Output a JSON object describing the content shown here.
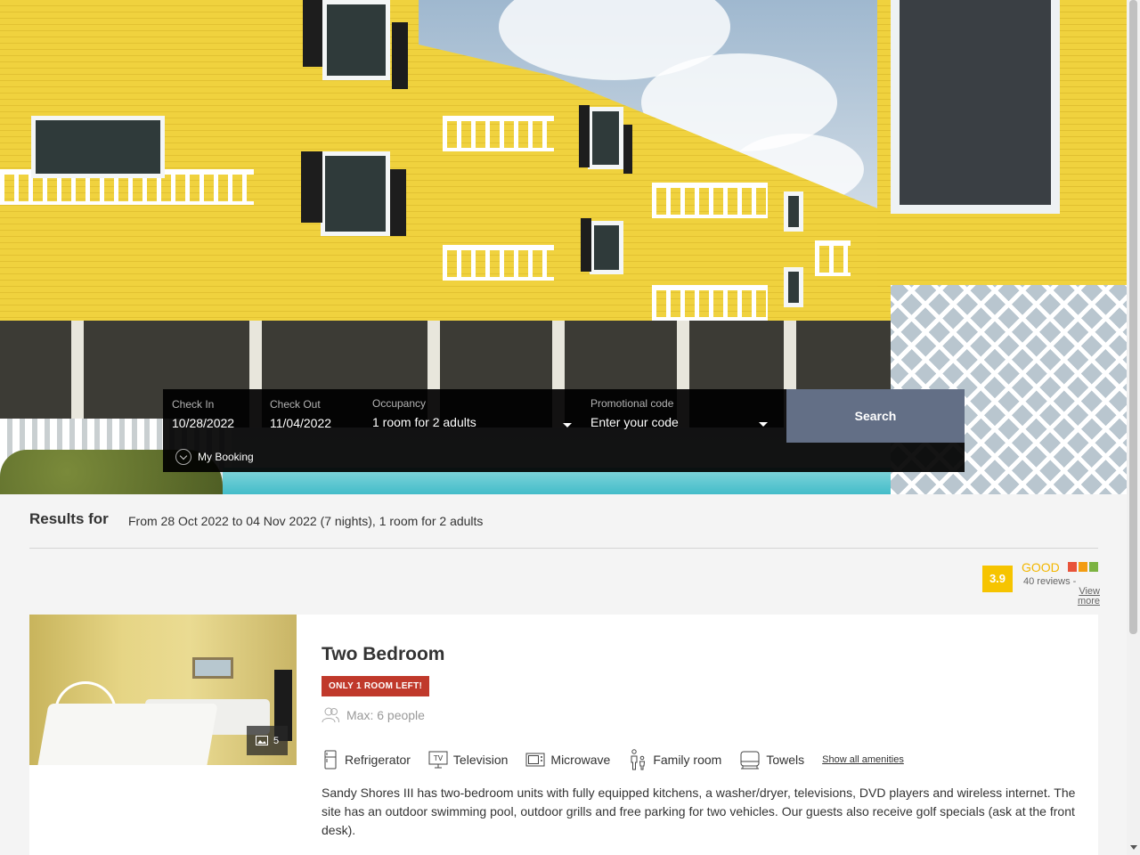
{
  "booking": {
    "check_in_label": "Check In",
    "check_in_value": "10/28/2022",
    "check_out_label": "Check Out",
    "check_out_value": "11/04/2022",
    "occupancy_label": "Occupancy",
    "occupancy_value": "1 room for 2 adults",
    "promo_label": "Promotional code",
    "promo_placeholder": "Enter your code",
    "search_label": "Search",
    "my_booking_label": "My Booking"
  },
  "results": {
    "heading": "Results for",
    "summary": "From 28 Oct 2022 to 04 Nov 2022 (7 nights), 1 room for 2 adults"
  },
  "rating": {
    "score": "3.9",
    "label": "GOOD",
    "reviews_text": "40 reviews - ",
    "view_more": "View more",
    "flag_colors": [
      "#e8533a",
      "#f39c12",
      "#7cb342"
    ],
    "label_color": "#f3b700"
  },
  "room": {
    "title": "Two Bedroom",
    "badge": "ONLY 1 ROOM LEFT!",
    "max_people": "Max: 6 people",
    "photo_count": "5",
    "amenities": [
      {
        "label": "Refrigerator",
        "icon": "refrigerator-icon"
      },
      {
        "label": "Television",
        "icon": "television-icon"
      },
      {
        "label": "Microwave",
        "icon": "microwave-icon"
      },
      {
        "label": "Family room",
        "icon": "family-room-icon"
      },
      {
        "label": "Towels",
        "icon": "towels-icon"
      }
    ],
    "show_all_amenities": "Show all amenities",
    "description": "Sandy Shores III has two-bedroom units with fully equipped kitchens, a washer/dryer, televisions, DVD players and wireless internet. The site has an outdoor swimming pool, outdoor grills and free parking for two vehicles. Our guests also receive golf specials (ask at the front desk)."
  },
  "colors": {
    "search_button": "#636f86",
    "badge": "#c0392b",
    "score_bg": "#f6c400"
  }
}
